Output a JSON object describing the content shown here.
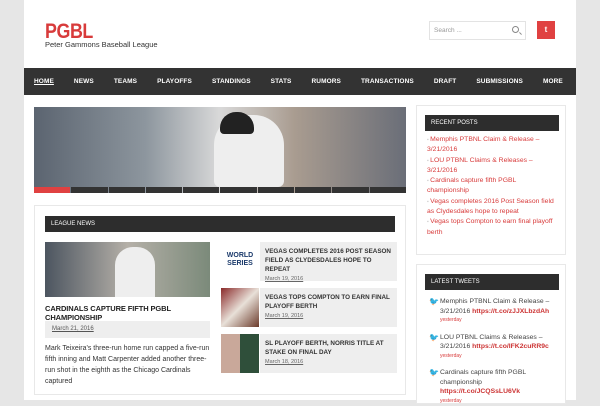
{
  "site": {
    "title": "PGBL",
    "tagline": "Peter Gammons Baseball League",
    "search_placeholder": "Search ...",
    "twitter_icon": "twitter-icon"
  },
  "nav": [
    "HOME",
    "NEWS",
    "TEAMS",
    "PLAYOFFS",
    "STANDINGS",
    "STATS",
    "RUMORS",
    "TRANSACTIONS",
    "DRAFT",
    "SUBMISSIONS",
    "MORE"
  ],
  "slider": {
    "slides": 10,
    "active": 1
  },
  "league_news": {
    "heading": "LEAGUE NEWS",
    "featured": {
      "title": "CARDINALS CAPTURE FIFTH PGBL CHAMPIONSHIP",
      "date": "March 21, 2016",
      "excerpt": "Mark Teixeira's three-run home run capped a five-run fifth inning and Matt Carpenter added another three-run shot in the eighth as the Chicago Cardinals captured"
    },
    "items": [
      {
        "title": "VEGAS COMPLETES 2016 POST SEASON FIELD AS CLYDESDALES HOPE TO REPEAT",
        "date": "March 19, 2016",
        "thumb": "WORLD SERIES"
      },
      {
        "title": "VEGAS TOPS COMPTON TO EARN FINAL PLAYOFF BERTH",
        "date": "March 19, 2016"
      },
      {
        "title": "SL PLAYOFF BERTH, NORRIS TITLE AT STAKE ON FINAL DAY",
        "date": "March 18, 2016"
      }
    ]
  },
  "recent_posts": {
    "heading": "RECENT POSTS",
    "items": [
      "Memphis PTBNL Claim & Release – 3/21/2016",
      "LOU PTBNL Claims & Releases – 3/21/2016",
      "Cardinals capture fifth PGBL championship",
      "Vegas completes 2016 Post Season field as Clydesdales hope to repeat",
      "Vegas tops Compton to earn final playoff berth"
    ]
  },
  "latest_tweets": {
    "heading": "LATEST TWEETS",
    "items": [
      {
        "text": "Memphis PTBNL Claim & Release – 3/21/2016 ",
        "link": "https://t.co/zJJXLbzdAh",
        "time": "yesterday"
      },
      {
        "text": "LOU PTBNL Claims & Releases – 3/21/2016 ",
        "link": "https://t.co/IFK2cuRR9c",
        "time": "yesterday"
      },
      {
        "text": "Cardinals capture fifth PGBL championship ",
        "link": "https://t.co/JCQSsLU6Vk",
        "time": "yesterday"
      }
    ]
  }
}
